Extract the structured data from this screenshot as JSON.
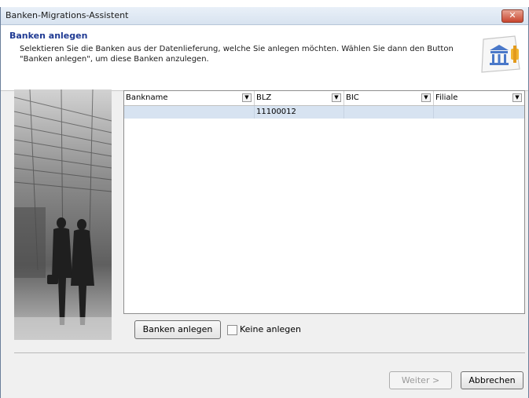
{
  "window": {
    "title": "Banken-Migrations-Assistent",
    "close_label": "✕"
  },
  "header": {
    "title": "Banken anlegen",
    "description": "Selektieren Sie die Banken aus der Datenlieferung, welche Sie anlegen möchten. Wählen Sie dann den Button \"Banken anlegen\", um diese Banken anzulegen.",
    "icon": "bank-building-icon"
  },
  "grid": {
    "columns": [
      "Bankname",
      "BLZ",
      "BIC",
      "Filiale"
    ],
    "rows": [
      [
        "",
        "11100012",
        "",
        ""
      ]
    ]
  },
  "actions": {
    "create_label": "Banken anlegen",
    "none_checkbox_label": "Keine anlegen",
    "none_checked": false
  },
  "footer": {
    "next_label": "Weiter >",
    "cancel_label": "Abbrechen",
    "next_enabled": false
  },
  "colors": {
    "header_title": "#1f3a93",
    "selected_row": "#d7e3f1"
  }
}
